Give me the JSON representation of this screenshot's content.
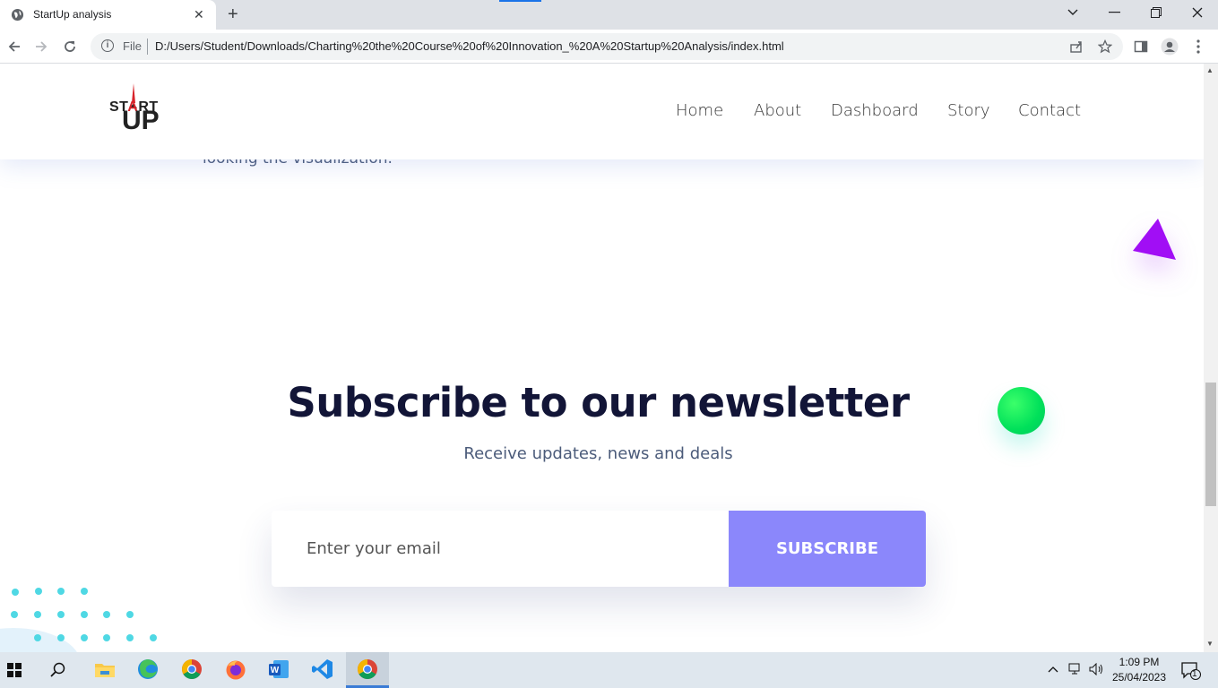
{
  "browser": {
    "tab_title": "StartUp analysis",
    "tab_close": "✕",
    "new_tab": "+",
    "omnibox": {
      "scheme_label": "File",
      "url": "D:/Users/Student/Downloads/Charting%20the%20Course%20of%20Innovation_%20A%20Startup%20Analysis/index.html"
    }
  },
  "site": {
    "logo": {
      "top": "ST",
      "arrow_letter": "A",
      "rest": "RT",
      "bottom": "UP"
    },
    "nav": [
      "Home",
      "About",
      "Dashboard",
      "Story",
      "Contact"
    ],
    "faded_text": "looking the visualization.",
    "newsletter": {
      "title": "Subscribe to our newsletter",
      "subtitle": "Receive updates, news and deals",
      "email_placeholder": "Enter your email",
      "button_label": "SUBSCRIBE"
    },
    "colors": {
      "accent_button": "#8b87fb",
      "triangle": "#a10ef5",
      "ball": "#00e05a",
      "heading": "#121537",
      "dots": "#4fd8e4"
    }
  },
  "taskbar": {
    "apps": [
      "start-icon",
      "search-icon",
      "file-explorer-icon",
      "edge-icon",
      "chrome-icon",
      "firefox-icon",
      "word-icon",
      "vscode-icon",
      "chrome-icon"
    ],
    "clock_time": "1:09 PM",
    "clock_date": "25/04/2023",
    "notification_count": "1"
  }
}
